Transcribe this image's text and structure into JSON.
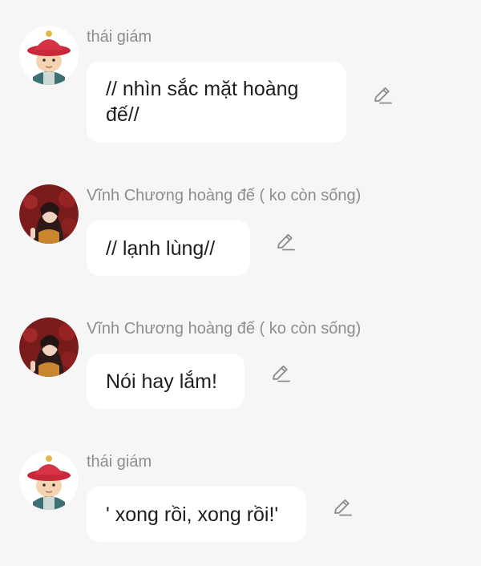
{
  "messages": [
    {
      "sender": "thái giám",
      "text": "// nhìn sắc mặt hoàng đế//",
      "avatar_icon": "eunuch-avatar-icon",
      "edit_icon": "pencil-edit-icon"
    },
    {
      "sender": "Vĩnh Chương hoàng đế ( ko còn sống)",
      "text": "// lạnh lùng//",
      "avatar_icon": "emperor-avatar-icon",
      "edit_icon": "pencil-edit-icon"
    },
    {
      "sender": "Vĩnh Chương hoàng đế ( ko còn sống)",
      "text": "Nói hay lắm!",
      "avatar_icon": "emperor-avatar-icon",
      "edit_icon": "pencil-edit-icon"
    },
    {
      "sender": "thái giám",
      "text": "' xong rồi, xong rồi!'",
      "avatar_icon": "eunuch-avatar-icon",
      "edit_icon": "pencil-edit-icon"
    }
  ],
  "colors": {
    "background": "#f6f6f6",
    "bubble": "#ffffff",
    "sender_name": "#8d8d8d",
    "message_text": "#1e1e1e",
    "edit_icon": "#8a8a8a"
  }
}
